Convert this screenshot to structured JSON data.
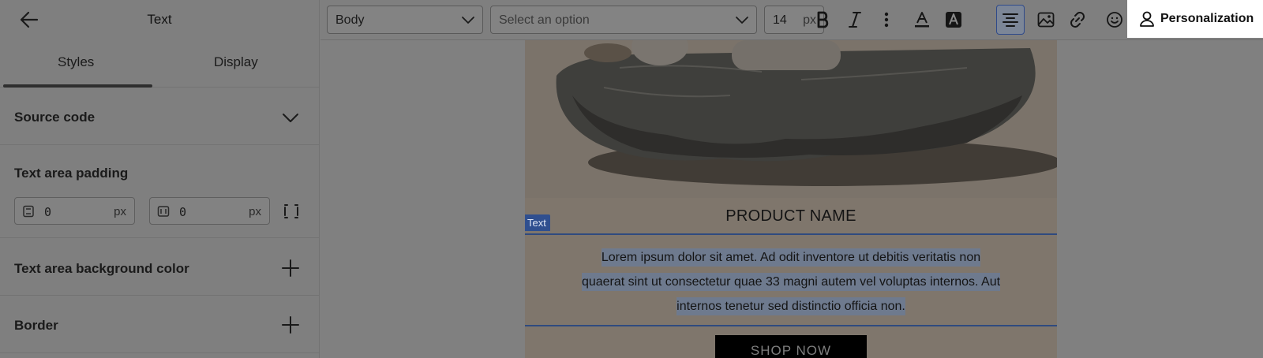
{
  "sidebar": {
    "title": "Text",
    "tabs": [
      {
        "label": "Styles",
        "active": true
      },
      {
        "label": "Display",
        "active": false
      }
    ],
    "sections": {
      "source_code": "Source code",
      "padding": {
        "label": "Text area padding",
        "left_value": "0",
        "right_value": "0",
        "unit": "px"
      },
      "background": "Text area background color",
      "border": "Border"
    }
  },
  "toolbar": {
    "style_select": "Body",
    "font_select_placeholder": "Select an option",
    "font_size": "14",
    "font_size_unit": "px",
    "personalization_label": "Personalization"
  },
  "canvas": {
    "product_name": "PRODUCT NAME",
    "text_tag": "Text",
    "paragraph": "Lorem ipsum dolor sit amet. Ad odit inventore ut debitis veritatis non quaerat sint ut consectetur quae 33 magni autem vel voluptas internos. Aut internos tenetur sed distinctio officia non.",
    "shop_button": "SHOP NOW"
  },
  "icons": {
    "back": "arrow-left-icon",
    "chevron": "chevron-down-icon",
    "plus": "plus-icon",
    "bold": "bold-icon",
    "italic": "italic-icon",
    "more": "more-vertical-icon",
    "text_color": "text-color-icon",
    "highlight": "highlight-icon",
    "align": "align-center-icon",
    "image": "image-icon",
    "link": "link-icon",
    "emoji": "emoji-icon",
    "user": "user-icon"
  },
  "colors": {
    "overlay_gray": "#808080",
    "selection_border": "#2f4a7f",
    "text_tag_bg": "#2f4f8f",
    "personalization_bg": "#ffffff"
  }
}
